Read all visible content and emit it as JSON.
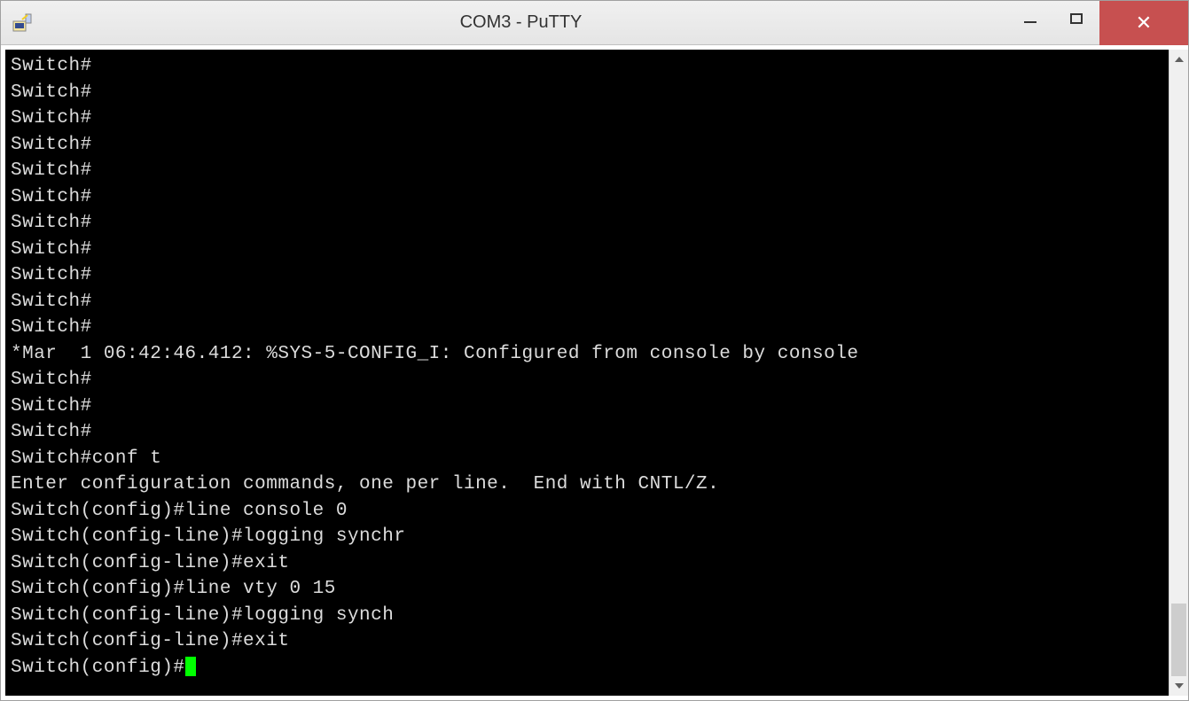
{
  "window": {
    "title": "COM3 - PuTTY"
  },
  "titlebar": {
    "minimize_tooltip": "Minimize",
    "maximize_tooltip": "Maximize",
    "close_tooltip": "Close"
  },
  "terminal": {
    "lines": [
      "Switch#",
      "Switch#",
      "Switch#",
      "Switch#",
      "Switch#",
      "Switch#",
      "Switch#",
      "Switch#",
      "Switch#",
      "Switch#",
      "Switch#",
      "*Mar  1 06:42:46.412: %SYS-5-CONFIG_I: Configured from console by console",
      "Switch#",
      "Switch#",
      "Switch#",
      "Switch#conf t",
      "Enter configuration commands, one per line.  End with CNTL/Z.",
      "Switch(config)#line console 0",
      "Switch(config-line)#logging synchr",
      "Switch(config-line)#exit",
      "Switch(config)#line vty 0 15",
      "Switch(config-line)#logging synch",
      "Switch(config-line)#exit"
    ],
    "current_prompt": "Switch(config)#"
  },
  "scrollbar": {
    "thumb_top_percent": 88,
    "thumb_height_percent": 12
  }
}
